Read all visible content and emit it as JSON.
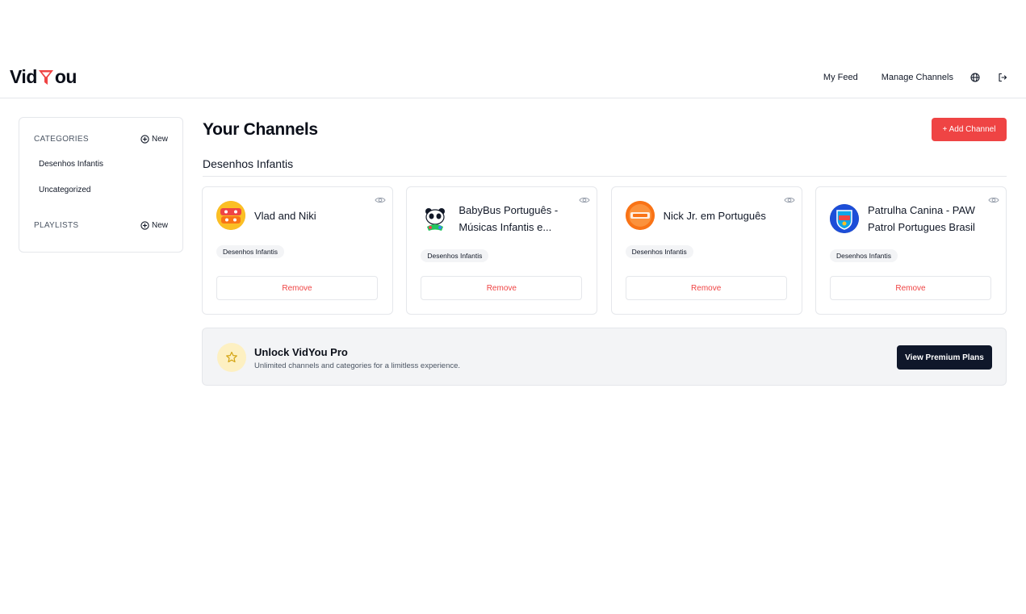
{
  "header": {
    "logo_left": "Vid",
    "logo_right": "ou",
    "nav": {
      "feed": "My Feed",
      "manage": "Manage Channels"
    },
    "icons": {
      "language": "globe-icon",
      "logout": "logout-icon"
    }
  },
  "sidebar": {
    "categories_title": "CATEGORIES",
    "new_label": "New",
    "categories": [
      "Desenhos Infantis",
      "Uncategorized"
    ],
    "playlists_title": "PLAYLISTS",
    "playlists_new_label": "New"
  },
  "main": {
    "title": "Your Channels",
    "add_button": "+ Add Channel",
    "category_heading": "Desenhos Infantis",
    "channels": [
      {
        "name": "Vlad and Niki",
        "category": "Desenhos Infantis",
        "remove": "Remove"
      },
      {
        "name": "BabyBus Português - Músicas Infantis e...",
        "category": "Desenhos Infantis",
        "remove": "Remove"
      },
      {
        "name": "Nick Jr. em Português",
        "category": "Desenhos Infantis",
        "remove": "Remove"
      },
      {
        "name": "Patrulha Canina - PAW Patrol Portugues Brasil",
        "category": "Desenhos Infantis",
        "remove": "Remove"
      }
    ]
  },
  "promo": {
    "title": "Unlock VidYou Pro",
    "subtitle": "Unlimited channels and categories for a limitless experience.",
    "button": "View Premium Plans"
  },
  "colors": {
    "accent": "#ef4444",
    "dark": "#0f172a",
    "border": "#e5e7eb",
    "muted_bg": "#f3f4f6"
  }
}
